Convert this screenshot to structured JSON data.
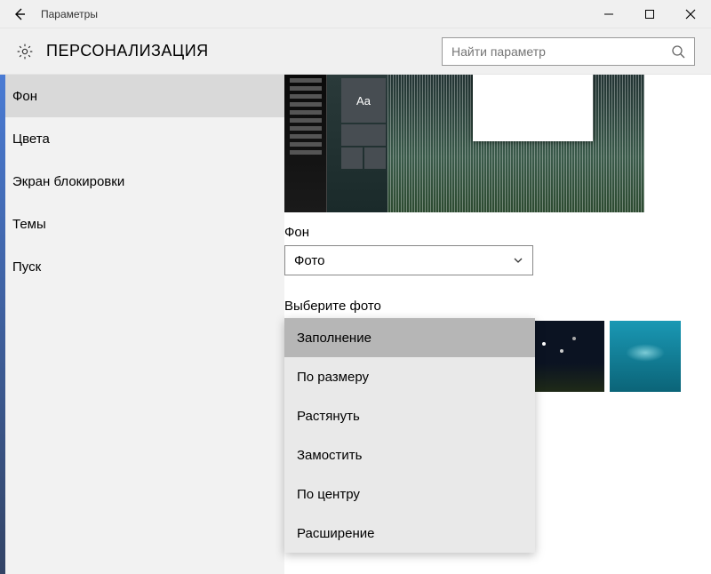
{
  "titlebar": {
    "title": "Параметры"
  },
  "header": {
    "page_title": "ПЕРСОНАЛИЗАЦИЯ"
  },
  "search": {
    "placeholder": "Найти параметр"
  },
  "sidebar": {
    "items": [
      {
        "label": "Фон"
      },
      {
        "label": "Цвета"
      },
      {
        "label": "Экран блокировки"
      },
      {
        "label": "Темы"
      },
      {
        "label": "Пуск"
      }
    ],
    "active_index": 0
  },
  "content": {
    "preview_text": "Aa",
    "background_label": "Фон",
    "background_value": "Фото",
    "choose_label": "Выберите фото"
  },
  "fit_menu": {
    "items": [
      {
        "label": "Заполнение"
      },
      {
        "label": "По размеру"
      },
      {
        "label": "Растянуть"
      },
      {
        "label": "Замостить"
      },
      {
        "label": "По центру"
      },
      {
        "label": "Расширение"
      }
    ],
    "selected_index": 0
  }
}
